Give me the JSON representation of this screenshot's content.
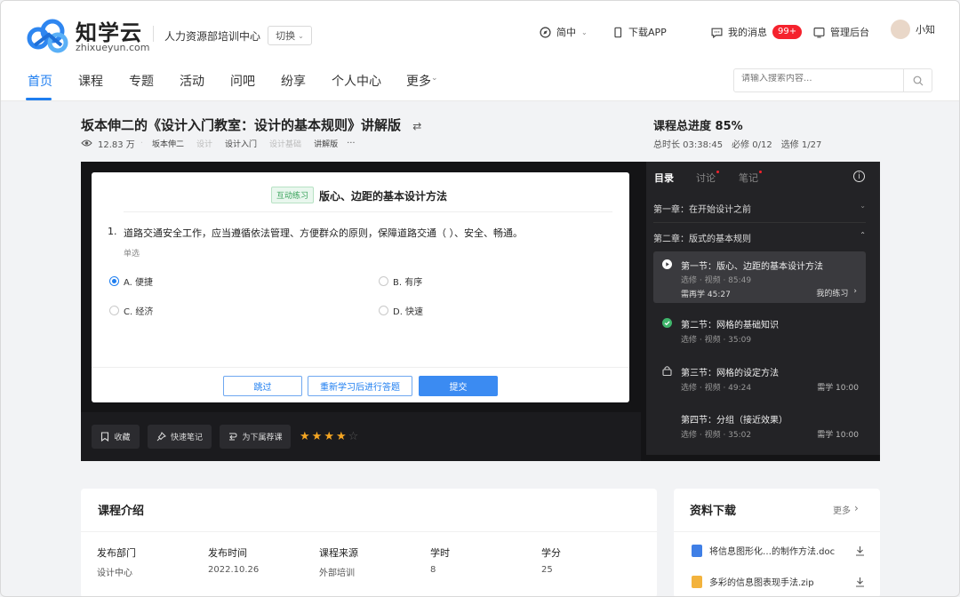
{
  "header": {
    "logo_cn": "知学云",
    "logo_en": "zhixueyun.com",
    "org": "人力资源部培训中心",
    "switch_label": "切换",
    "lang_label": "简中",
    "download_label": "下载APP",
    "messages_label": "我的消息",
    "messages_badge": "99+",
    "admin_label": "管理后台",
    "user_name": "小知"
  },
  "nav": {
    "items": [
      "首页",
      "课程",
      "专题",
      "活动",
      "问吧",
      "纷享",
      "个人中心",
      "更多"
    ],
    "active": "首页"
  },
  "search": {
    "placeholder": "请输入搜索内容..."
  },
  "course": {
    "title": "坂本伸二的《设计入门教室：设计的基本规则》讲解版",
    "views": "12.83 万",
    "tags": [
      "坂本伸二",
      "设计",
      "设计入门",
      "设计基础",
      "讲解版"
    ],
    "more": "···",
    "progress_title": "课程总进度 85%",
    "total_time": "总时长 03:38:45",
    "required": "必修 0/12",
    "elective": "选修 1/27"
  },
  "quiz": {
    "tag": "互动练习",
    "heading": "版心、边距的基本设计方法",
    "number": "1.",
    "question": "道路交通安全工作，应当遵循依法管理、方便群众的原则，保障道路交通（ ）、安全、畅通。",
    "type": "单选",
    "options": [
      "A. 便捷",
      "B. 有序",
      "C. 经济",
      "D. 快速"
    ],
    "selected_index": 0,
    "skip_label": "跳过",
    "relearn_label": "重新学习后进行答题",
    "submit_label": "提交"
  },
  "player_actions": {
    "favorite_label": "收藏",
    "note_label": "快速笔记",
    "recommend_label": "为下属荐课",
    "rating": 4,
    "rating_max": 5
  },
  "sidebar": {
    "tabs": [
      "目录",
      "讨论",
      "笔记"
    ],
    "info_symbol": "i",
    "chapters": [
      {
        "title": "第一章：在开始设计之前",
        "expanded": false
      },
      {
        "title": "第二章：版式的基本规则",
        "expanded": true
      }
    ],
    "sections": [
      {
        "title": "第一节：版心、边距的基本设计方法",
        "sub": "选修 · 视频 · 85:49",
        "extra_left": "需再学 45:27",
        "extra_right": "我的练习",
        "status": "playing"
      },
      {
        "title": "第二节：网格的基础知识",
        "sub": "选修 · 视频 · 35:09",
        "status": "done"
      },
      {
        "title": "第三节：网格的设定方法",
        "sub": "选修 · 视频 · 49:24",
        "right": "需学 10:00",
        "status": "locked"
      },
      {
        "title": "第四节：分组（接近效果）",
        "sub": "选修 · 视频 · 35:02",
        "right": "需学 10:00",
        "status": "none"
      }
    ]
  },
  "intro": {
    "title": "课程介绍",
    "fields": [
      {
        "k": "发布部门",
        "v": "设计中心"
      },
      {
        "k": "发布时间",
        "v": "2022.10.26"
      },
      {
        "k": "课程来源",
        "v": "外部培训"
      },
      {
        "k": "学时",
        "v": "8"
      },
      {
        "k": "学分",
        "v": "25"
      }
    ]
  },
  "downloads": {
    "title": "资料下载",
    "more_label": "更多",
    "files": [
      "将信息图形化…的制作方法.doc",
      "多彩的信息图表现手法.zip"
    ]
  },
  "colors": {
    "accent": "#1e7ef0",
    "badge": "#f5222d",
    "player_bg": "#141416",
    "star": "#f5a623"
  }
}
